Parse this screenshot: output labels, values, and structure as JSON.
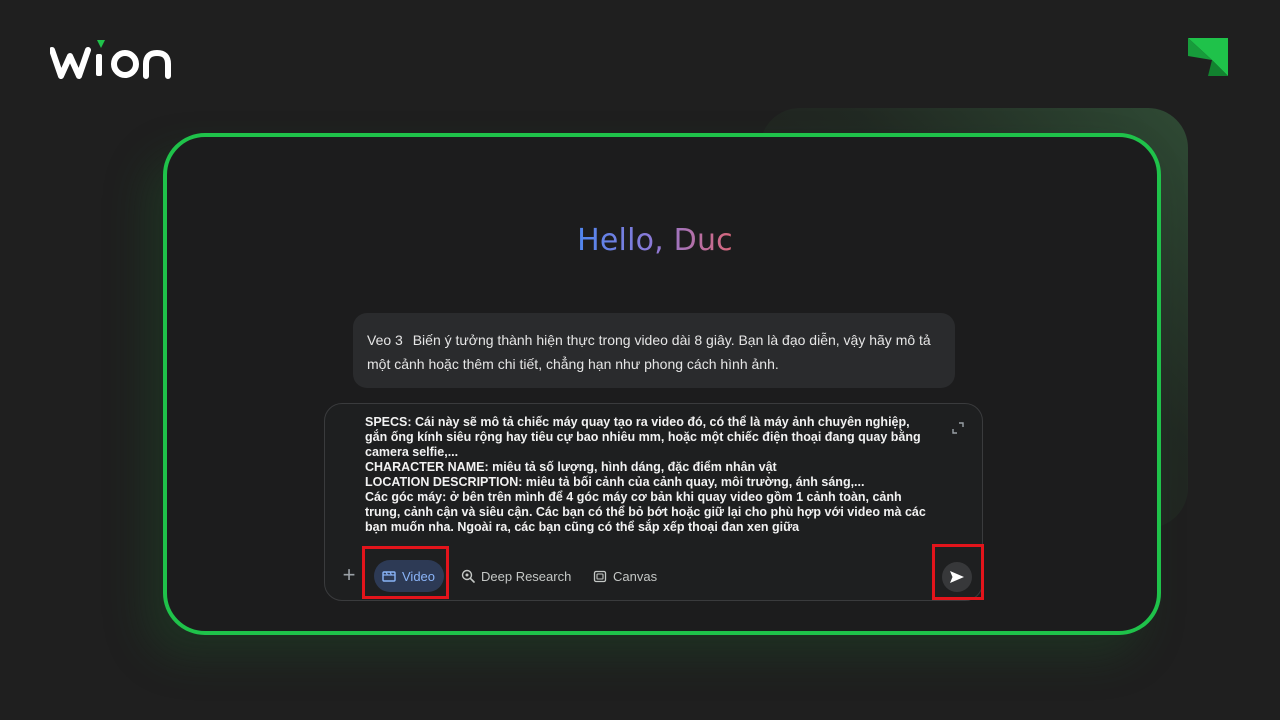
{
  "brand": {
    "logo_text": "wion",
    "accent_color": "#1fc24a"
  },
  "greeting": "Hello, Duc",
  "info_card": {
    "badge": "Veo 3",
    "text": "Biến ý tưởng thành hiện thực trong video dài 8 giây. Bạn là đạo diễn, vậy hãy mô tả một cảnh hoặc thêm chi tiết, chẳng hạn như phong cách hình ảnh."
  },
  "composer": {
    "text": "SPECS: Cái này sẽ mô tả chiếc máy quay tạo ra video đó, có thể là máy ảnh chuyên nghiệp, gắn ống kính siêu rộng hay tiêu cự bao nhiêu mm, hoặc một chiếc điện thoại đang quay bằng camera selfie,...\nCHARACTER NAME: miêu tả số lượng, hình dáng, đặc điểm nhân vật\nLOCATION DESCRIPTION: miêu tả bối cảnh của cảnh quay, môi trường, ánh sáng,...\nCác góc máy: ở bên trên mình để 4 góc máy cơ bản khi quay video gồm 1 cảnh toàn, cảnh trung, cảnh cận và siêu cận. Các bạn có thể bỏ bớt hoặc giữ lại cho phù hợp với video mà các bạn muốn nha. Ngoài ra, các bạn cũng có thể sắp xếp thoại đan xen giữa",
    "expand_icon": "expand-icon"
  },
  "toolbar": {
    "plus_icon": "plus-icon",
    "video_label": "Video",
    "deep_research_label": "Deep Research",
    "canvas_label": "Canvas",
    "send_icon": "send-icon"
  },
  "highlight_color": "#e3141b"
}
